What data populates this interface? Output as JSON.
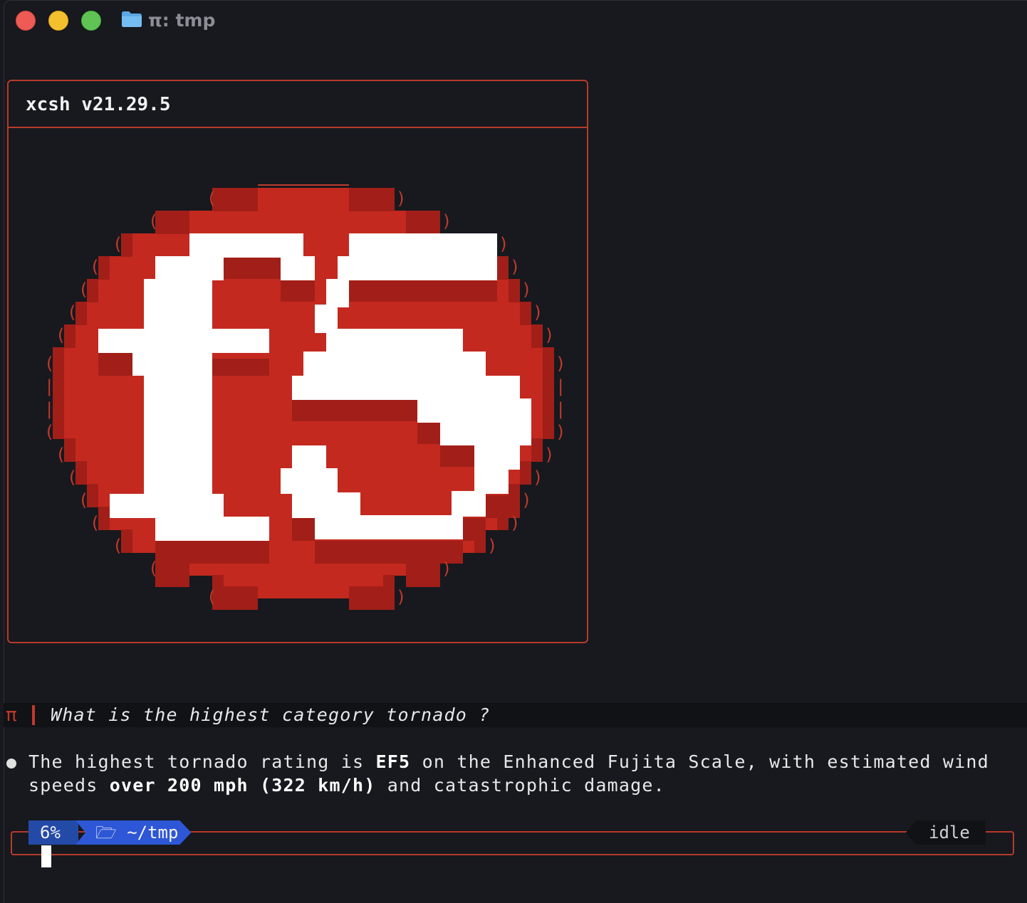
{
  "window": {
    "title": "π: tmp"
  },
  "banner": {
    "title": "xcsh v21.29.5"
  },
  "prompt": {
    "symbol": "π",
    "question": "What is the highest category tornado ?"
  },
  "answer": {
    "p1": "The highest tornado rating is ",
    "b1": "EF5",
    "p2": " on the Enhanced Fujita Scale, with estimated wind",
    "p3": "speeds ",
    "b2": "over 200 mph (322 km/h)",
    "p4": " and catastrophic damage."
  },
  "status": {
    "percent": "6%",
    "directory": "🗁 ~/tmp",
    "state": "idle"
  },
  "colors": {
    "accent": "#b83a2b",
    "logo_red": "#c4291f",
    "logo_dark": "#a11f18",
    "pill_blue": "#2d57d6"
  }
}
